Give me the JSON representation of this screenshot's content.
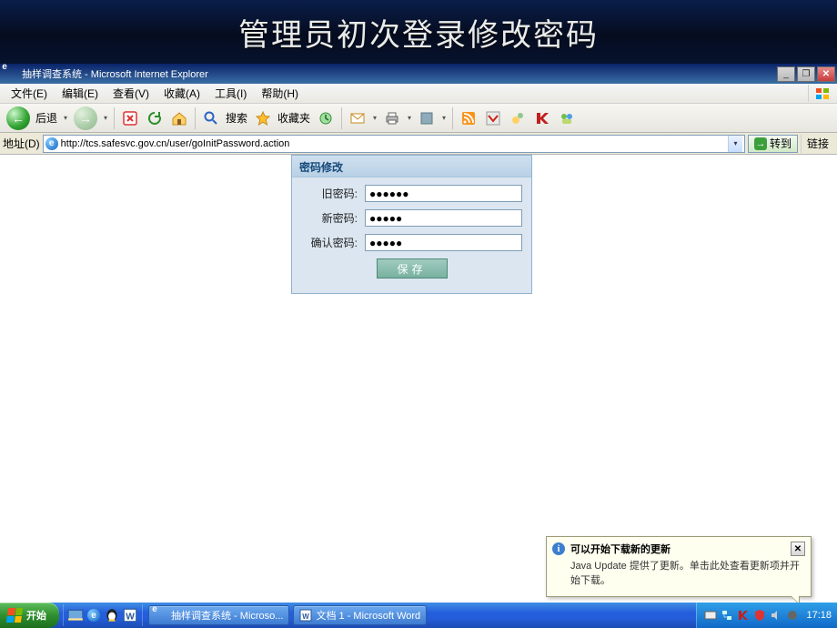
{
  "banner": {
    "title": "管理员初次登录修改密码"
  },
  "window": {
    "title": "抽样调查系统 - Microsoft Internet Explorer",
    "minimize": "_",
    "restore": "❐",
    "close": "✕"
  },
  "menus": {
    "file": "文件(E)",
    "edit": "编辑(E)",
    "view": "查看(V)",
    "fav": "收藏(A)",
    "tools": "工具(I)",
    "help": "帮助(H)"
  },
  "toolbar": {
    "back": "后退",
    "search": "搜索",
    "favorites": "收藏夹"
  },
  "address": {
    "label": "地址(D)",
    "url": "http://tcs.safesvc.gov.cn/user/goInitPassword.action",
    "go": "转到",
    "links": "链接"
  },
  "card": {
    "title": "密码修改",
    "old_label": "旧密码:",
    "old_value": "●●●●●●",
    "new_label": "新密码:",
    "new_value": "●●●●●",
    "confirm_label": "确认密码:",
    "confirm_value": "●●●●●",
    "save": "保存"
  },
  "notif": {
    "title": "可以开始下载新的更新",
    "body": "Java Update 提供了更新。单击此处查看更新项并开始下载。",
    "close": "✕"
  },
  "taskbar": {
    "start": "开始",
    "tasks": [
      {
        "label": "抽样调查系统 - Microso..."
      },
      {
        "label": "文档 1 - Microsoft Word"
      }
    ],
    "clock": "17:18"
  },
  "colors": {
    "banner_bg": "#0a1e4a",
    "card_bg": "#dbe6f0",
    "card_border": "#8fb2cf",
    "save_bg": "#78b1a0"
  }
}
